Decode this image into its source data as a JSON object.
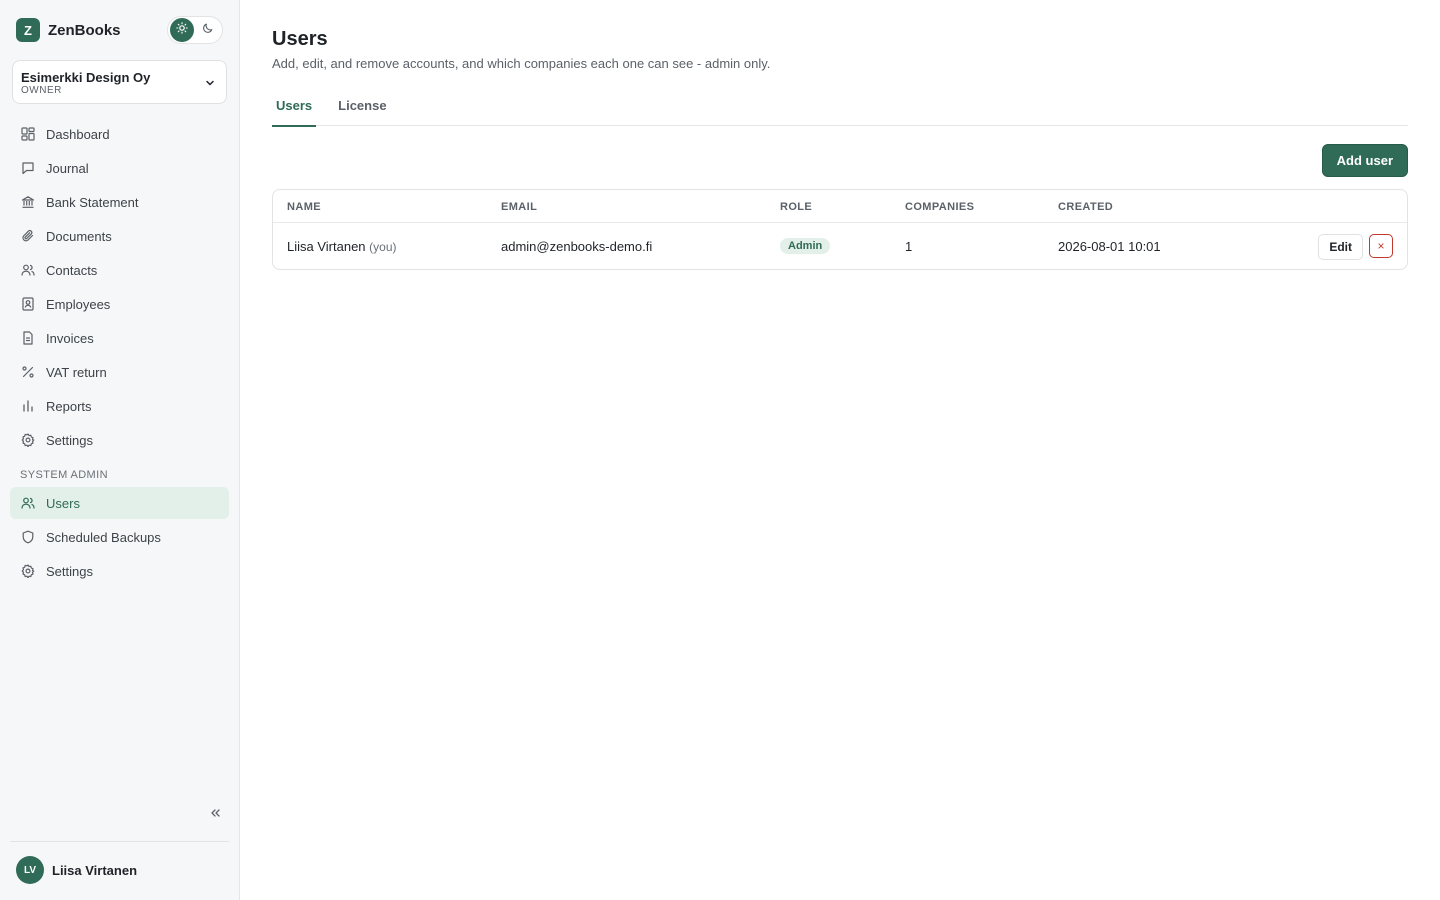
{
  "brand": {
    "logo_letter": "Z",
    "name": "ZenBooks"
  },
  "theme_toggle": {
    "light_icon": "sun-icon",
    "dark_icon": "moon-icon",
    "active": "light"
  },
  "company": {
    "name": "Esimerkki Design Oy",
    "role": "OWNER"
  },
  "nav": {
    "main": [
      {
        "label": "Dashboard",
        "icon": "dashboard-icon"
      },
      {
        "label": "Journal",
        "icon": "journal-icon"
      },
      {
        "label": "Bank Statement",
        "icon": "bank-icon"
      },
      {
        "label": "Documents",
        "icon": "paperclip-icon"
      },
      {
        "label": "Contacts",
        "icon": "contacts-icon"
      },
      {
        "label": "Employees",
        "icon": "employee-icon"
      },
      {
        "label": "Invoices",
        "icon": "invoice-icon"
      },
      {
        "label": "VAT return",
        "icon": "percent-icon"
      },
      {
        "label": "Reports",
        "icon": "bar-chart-icon"
      },
      {
        "label": "Settings",
        "icon": "gear-icon"
      }
    ],
    "admin_label": "SYSTEM ADMIN",
    "admin": [
      {
        "label": "Users",
        "icon": "users-icon",
        "active": true
      },
      {
        "label": "Scheduled Backups",
        "icon": "shield-icon"
      },
      {
        "label": "Settings",
        "icon": "gear-icon"
      }
    ]
  },
  "user": {
    "initials": "LV",
    "name": "Liisa Virtanen"
  },
  "page": {
    "title": "Users",
    "subtitle": "Add, edit, and remove accounts, and which companies each one can see - admin only.",
    "tabs": [
      {
        "label": "Users",
        "active": true
      },
      {
        "label": "License"
      }
    ],
    "add_button": "Add user"
  },
  "table": {
    "headers": {
      "name": "NAME",
      "email": "EMAIL",
      "role": "ROLE",
      "companies": "COMPANIES",
      "created": "CREATED"
    },
    "rows": [
      {
        "name": "Liisa Virtanen",
        "you": "(you)",
        "email": "admin@zenbooks-demo.fi",
        "role": "Admin",
        "companies": "1",
        "created": "2026-08-01 10:01",
        "edit_label": "Edit",
        "delete_label": "×"
      }
    ]
  },
  "colors": {
    "accent": "#2f6b57",
    "accent_soft": "#e3efe9",
    "danger": "#c0392b"
  }
}
